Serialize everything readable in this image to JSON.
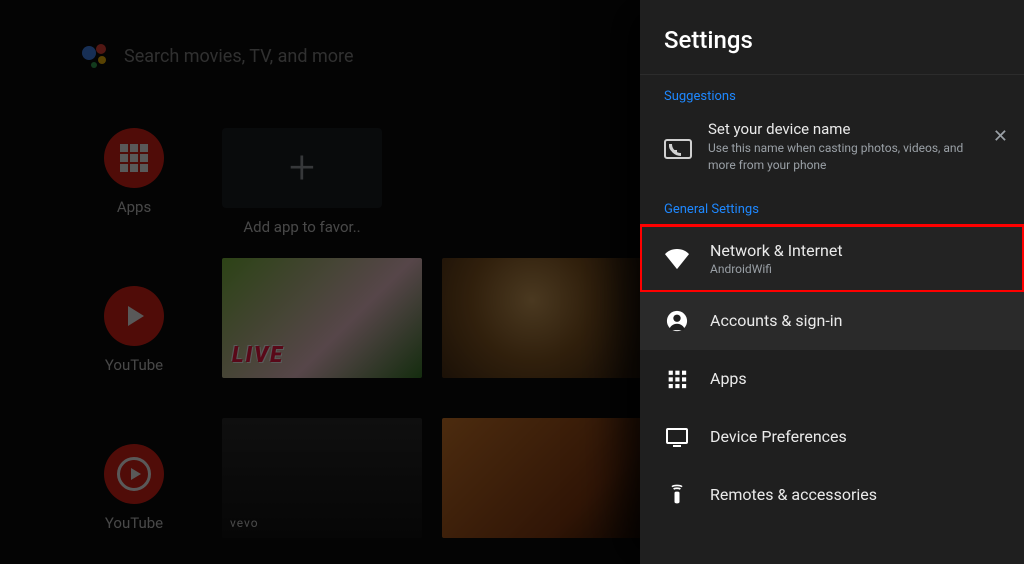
{
  "search": {
    "placeholder": "Search movies, TV, and more"
  },
  "home": {
    "apps_label": "Apps",
    "youtube_label": "YouTube",
    "youtube_label_2": "YouTube",
    "add_fav_label": "Add app to favor..",
    "live_tag": "LIVE",
    "vevo_tag": "vevo"
  },
  "panel": {
    "title": "Settings",
    "suggestions_label": "Suggestions",
    "general_label": "General Settings",
    "suggestion": {
      "title": "Set your device name",
      "subtitle": "Use this name when casting photos, videos, and more from your phone"
    },
    "items": [
      {
        "label": "Network & Internet",
        "sub": "AndroidWifi"
      },
      {
        "label": "Accounts & sign-in",
        "sub": ""
      },
      {
        "label": "Apps",
        "sub": ""
      },
      {
        "label": "Device Preferences",
        "sub": ""
      },
      {
        "label": "Remotes & accessories",
        "sub": ""
      }
    ]
  }
}
